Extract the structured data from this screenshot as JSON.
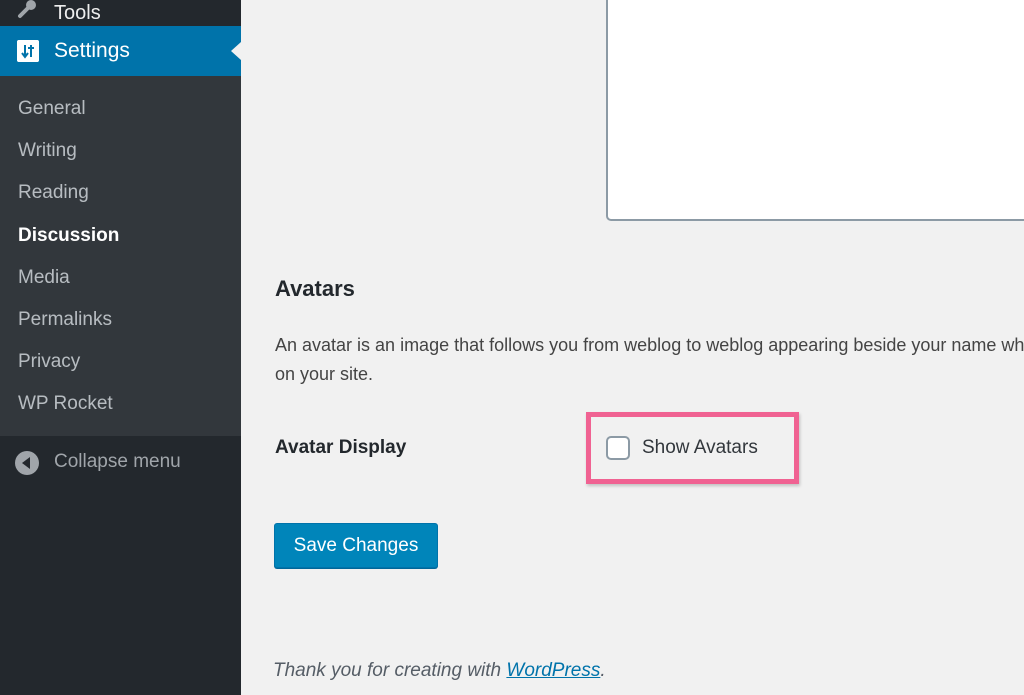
{
  "sidebar": {
    "tools_label": "Tools",
    "settings_label": "Settings",
    "submenu": [
      {
        "label": "General",
        "current": false
      },
      {
        "label": "Writing",
        "current": false
      },
      {
        "label": "Reading",
        "current": false
      },
      {
        "label": "Discussion",
        "current": true
      },
      {
        "label": "Media",
        "current": false
      },
      {
        "label": "Permalinks",
        "current": false
      },
      {
        "label": "Privacy",
        "current": false
      },
      {
        "label": "WP Rocket",
        "current": false
      }
    ],
    "collapse_label": "Collapse menu"
  },
  "main": {
    "section_title": "Avatars",
    "description_line1": "An avatar is an image that follows you from weblog to weblog appearing beside your name when you comment on avatar enabled sites. Here you can enable the display of avatars for people who comment",
    "description_line2": "on your site.",
    "avatar_display_label": "Avatar Display",
    "show_avatars_label": "Show Avatars",
    "show_avatars_checked": false,
    "save_button_label": "Save Changes",
    "highlight_color": "#f06292"
  },
  "footer": {
    "text_prefix": "Thank you for creating with ",
    "link_text": "WordPress",
    "text_suffix": "."
  },
  "colors": {
    "accent": "#0073aa",
    "sidebar_bg": "#23282d",
    "submenu_bg": "#32373c",
    "button": "#0085ba"
  }
}
